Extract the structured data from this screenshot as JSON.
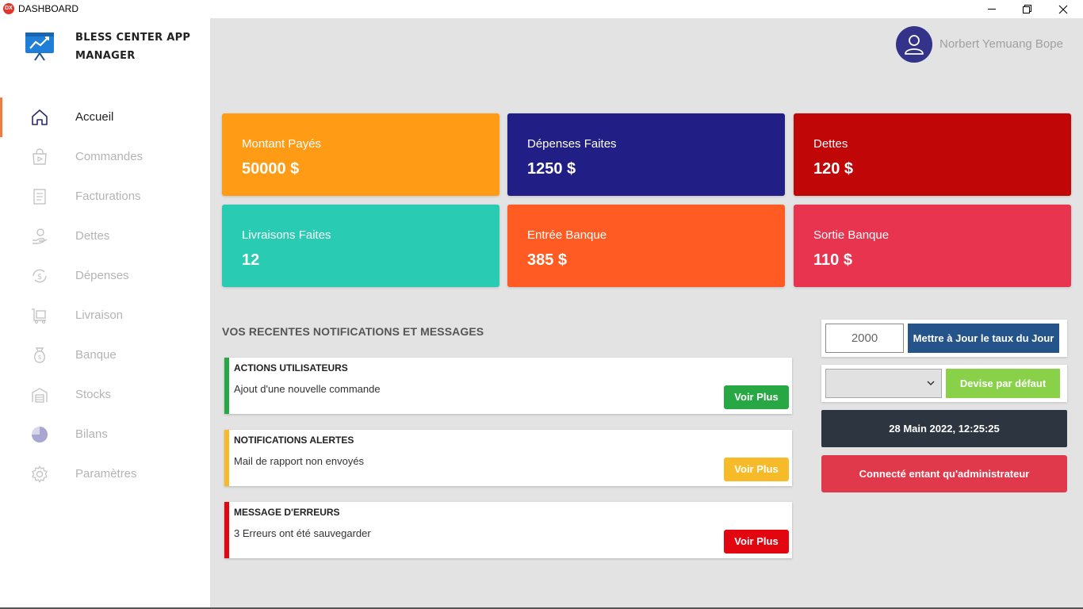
{
  "window": {
    "title": "DASHBOARD",
    "badge": "DX",
    "controls": [
      "minimize-icon",
      "restore-icon",
      "close-icon"
    ]
  },
  "brand": {
    "name": "BLESS CENTER APP MANAGER",
    "logo_icon": "chart-board-icon"
  },
  "sidebar": {
    "items": [
      {
        "label": "Accueil",
        "icon": "home-icon",
        "active": true
      },
      {
        "label": "Commandes",
        "icon": "shopping-bag-icon"
      },
      {
        "label": "Facturations",
        "icon": "invoice-icon"
      },
      {
        "label": "Dettes",
        "icon": "hand-money-icon"
      },
      {
        "label": "Dépenses",
        "icon": "dollar-cycle-icon"
      },
      {
        "label": "Livraison",
        "icon": "delivery-cart-icon"
      },
      {
        "label": "Banque",
        "icon": "bank-bag-icon"
      },
      {
        "label": "Stocks",
        "icon": "warehouse-icon"
      },
      {
        "label": "Bilans",
        "icon": "pie-chart-icon"
      },
      {
        "label": "Paramètres",
        "icon": "gear-icon"
      }
    ]
  },
  "user": {
    "name": "Norbert Yemuang Bope",
    "icon": "user-icon"
  },
  "cards": [
    {
      "label": "Montant Payés",
      "value": "50000 $",
      "color": "#ff9b14"
    },
    {
      "label": "Dépenses Faites",
      "value": "1250 $",
      "color": "#211f86"
    },
    {
      "label": "Dettes",
      "value": "120 $",
      "color": "#c10608"
    },
    {
      "label": "Livraisons Faites",
      "value": "12",
      "color": "#29cbb3"
    },
    {
      "label": "Entrée Banque",
      "value": "385 $",
      "color": "#ff5b22"
    },
    {
      "label": "Sortie Banque",
      "value": "110 $",
      "color": "#e8344f"
    }
  ],
  "notifications": {
    "section_title": "VOS RECENTES NOTIFICATIONS ET MESSAGES",
    "items": [
      {
        "title": "ACTIONS UTILISATEURS",
        "text": "Ajout d'une nouvelle commande",
        "button": "Voir Plus",
        "color": "#28a745"
      },
      {
        "title": "NOTIFICATIONS ALERTES",
        "text": "Mail de rapport non envoyés",
        "button": "Voir Plus",
        "color": "#f7bb2a"
      },
      {
        "title": "MESSAGE D'ERREURS",
        "text": "3 Erreurs ont été sauvegarder",
        "button": "Voir Plus",
        "color": "#e20610"
      }
    ]
  },
  "rate": {
    "value": "2000",
    "button": "Mettre à Jour le taux du Jour"
  },
  "currency": {
    "selected": "",
    "button": "Devise par défaut"
  },
  "datetime": "28 Main 2022, 12:25:25",
  "role_status": "Connecté entant qu'administrateur",
  "colors": {
    "accent": "#f07b3f",
    "sidebar_bg": "#ffffff",
    "main_bg": "#e3e3e3",
    "avatar": "#33338a"
  }
}
